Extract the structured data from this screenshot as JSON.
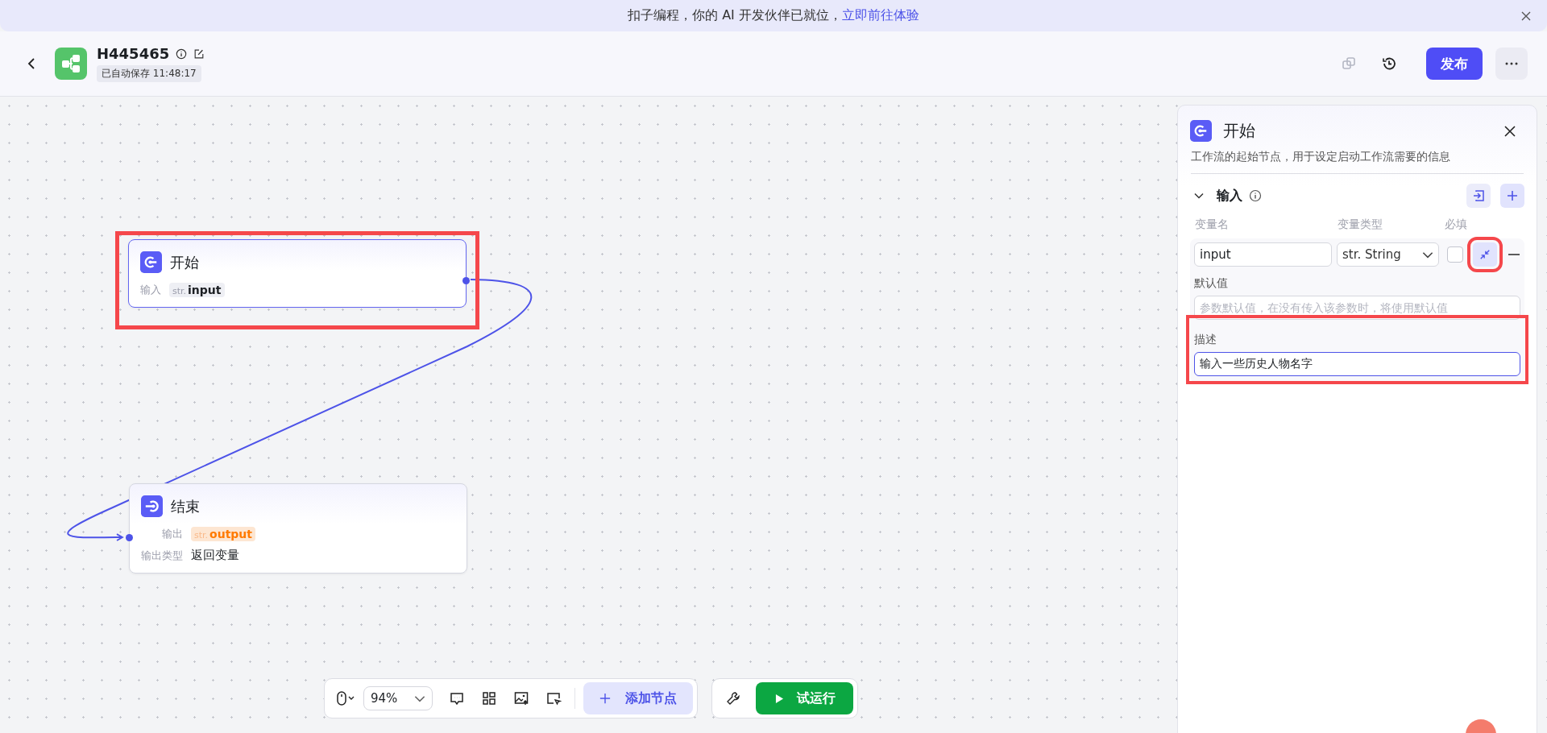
{
  "banner": {
    "text": "扣子编程，你的 AI 开发伙伴已就位，",
    "link": "立即前往体验"
  },
  "header": {
    "title": "H445465",
    "saved": "已自动保存 11:48:17",
    "publish": "发布"
  },
  "nodes": [
    {
      "kind": "start",
      "title": "开始",
      "selected": true,
      "highlighted": true,
      "rows": [
        {
          "kind": "input",
          "label": "输入",
          "type": "str.",
          "value": "input"
        }
      ]
    },
    {
      "kind": "end",
      "title": "结束",
      "selected": false,
      "highlighted": false,
      "rows": [
        {
          "kind": "output",
          "label": "输出",
          "type": "str.",
          "value": "output"
        },
        {
          "kind": "text",
          "label": "输出类型",
          "value": "返回变量"
        }
      ]
    }
  ],
  "panel": {
    "title": "开始",
    "description": "工作流的起始节点，用于设定启动工作流需要的信息",
    "section": "输入",
    "expanded": true,
    "columns": [
      "变量名",
      "变量类型",
      "必填"
    ],
    "variable": {
      "name": "input",
      "type": "str. String",
      "required": false,
      "collapse_highlighted": true,
      "default_label": "默认值",
      "default_placeholder": "参数默认值，在没有传入该参数时，将使用默认值",
      "description_label": "描述",
      "description": "输入一些历史人物名字",
      "description_highlighted": true
    }
  },
  "toolbar": {
    "zoom": "94%",
    "add": "添加节点",
    "run": "试运行"
  }
}
